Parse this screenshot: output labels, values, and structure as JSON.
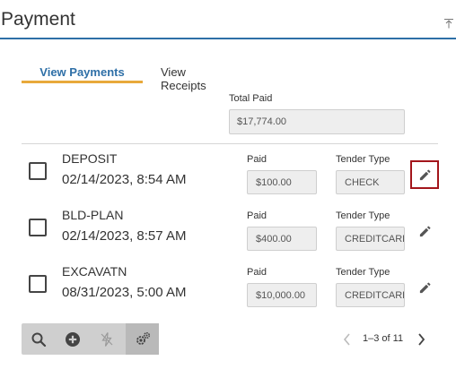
{
  "header": {
    "title": "Payment",
    "collapse_icon": "collapse-up-icon"
  },
  "tabs": [
    {
      "label": "View Payments",
      "active": true
    },
    {
      "label": "View Receipts",
      "active": false
    }
  ],
  "total": {
    "label": "Total Paid",
    "value": "$17,774.00"
  },
  "payments": [
    {
      "code": "DEPOSIT",
      "date": "02/14/2023, 8:54 AM",
      "paid_label": "Paid",
      "paid": "$100.00",
      "tender_label": "Tender Type",
      "tender": "CHECK",
      "checked": false
    },
    {
      "code": "BLD-PLAN",
      "date": "02/14/2023, 8:57 AM",
      "paid_label": "Paid",
      "paid": "$400.00",
      "tender_label": "Tender Type",
      "tender": "CREDITCARD",
      "checked": false
    },
    {
      "code": "EXCAVATN",
      "date": "08/31/2023, 5:00 AM",
      "paid_label": "Paid",
      "paid": "$10,000.00",
      "tender_label": "Tender Type",
      "tender": "CREDITCARD",
      "checked": false
    }
  ],
  "toolbar": {
    "icons": [
      "search-icon",
      "add-icon",
      "bolt-disabled-icon",
      "settings-icon"
    ]
  },
  "pager": {
    "text": "1–3 of 11"
  },
  "colors": {
    "accent": "#2e6fa7",
    "tab_underline": "#e8a93b",
    "focus_border": "#a3151b"
  }
}
